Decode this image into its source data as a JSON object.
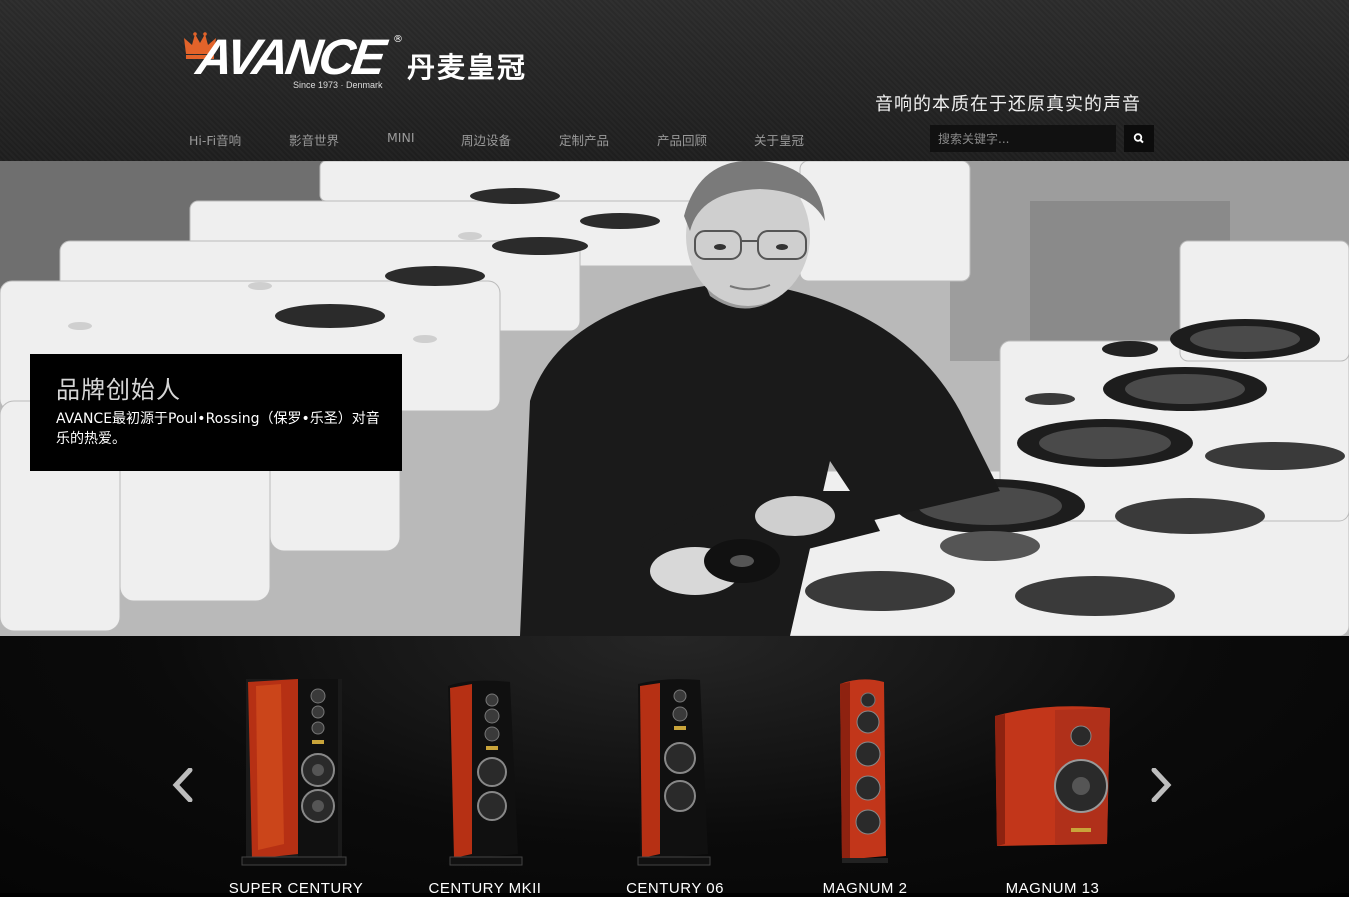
{
  "brand": {
    "logo_text": "AVANCE",
    "logo_cn": "丹麦皇冠",
    "logo_since": "Since 1973 · Denmark",
    "accent": "#e2632a"
  },
  "header": {
    "slogan": "音响的本质在于还原真实的声音"
  },
  "nav": {
    "items": [
      {
        "label": "Hi-Fi音响"
      },
      {
        "label": "影音世界"
      },
      {
        "label": "MINI"
      },
      {
        "label": "周边设备"
      },
      {
        "label": "定制产品"
      },
      {
        "label": "产品回顾"
      },
      {
        "label": "关于皇冠"
      }
    ]
  },
  "search": {
    "placeholder": "搜索关键字...",
    "icon": "search-icon"
  },
  "hero": {
    "caption_title": "品牌创始人",
    "caption_text": "AVANCE最初源于Poul•Rossing（保罗•乐圣）对音乐的热爱。"
  },
  "carousel": {
    "prev_icon": "chevron-left-icon",
    "next_icon": "chevron-right-icon",
    "products": [
      {
        "name": "SUPER CENTURY"
      },
      {
        "name": "CENTURY MKII"
      },
      {
        "name": "CENTURY 06"
      },
      {
        "name": "MAGNUM 2"
      },
      {
        "name": "MAGNUM 13"
      }
    ]
  }
}
